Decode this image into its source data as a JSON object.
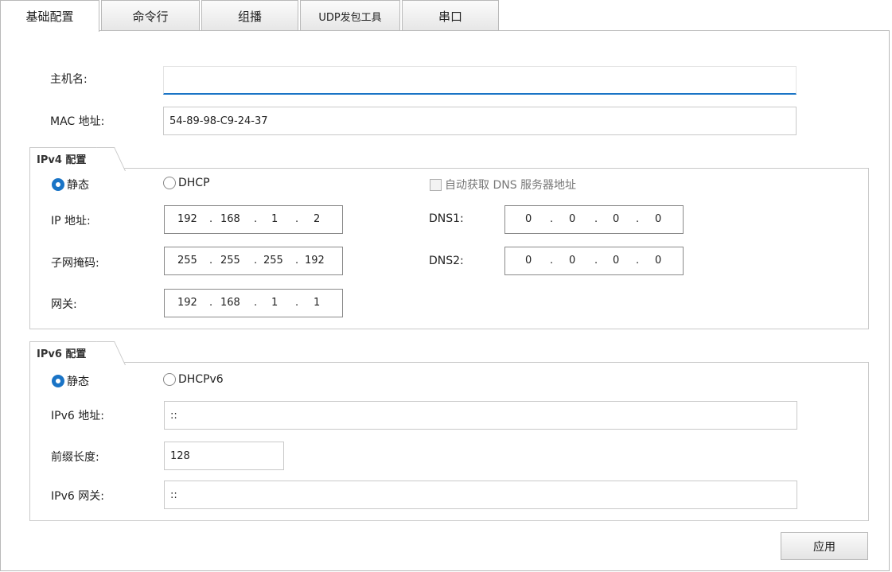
{
  "tabs": [
    {
      "label": "基础配置",
      "active": true
    },
    {
      "label": "命令行",
      "active": false
    },
    {
      "label": "组播",
      "active": false
    },
    {
      "label": "UDP发包工具",
      "active": false
    },
    {
      "label": "串口",
      "active": false
    }
  ],
  "basic": {
    "hostname_label": "主机名:",
    "hostname_value": "",
    "mac_label": "MAC 地址:",
    "mac_value": "54-89-98-C9-24-37"
  },
  "ipv4": {
    "legend": "IPv4 配置",
    "static_label": "静态",
    "dhcp_label": "DHCP",
    "mode": "static",
    "auto_dns_label": "自动获取 DNS 服务器地址",
    "auto_dns_checked": false,
    "ip_label": "IP 地址:",
    "ip": [
      "192",
      "168",
      "1",
      "2"
    ],
    "mask_label": "子网掩码:",
    "mask": [
      "255",
      "255",
      "255",
      "192"
    ],
    "gateway_label": "网关:",
    "gateway": [
      "192",
      "168",
      "1",
      "1"
    ],
    "dns1_label": "DNS1:",
    "dns1": [
      "0",
      "0",
      "0",
      "0"
    ],
    "dns2_label": "DNS2:",
    "dns2": [
      "0",
      "0",
      "0",
      "0"
    ]
  },
  "ipv6": {
    "legend": "IPv6 配置",
    "static_label": "静态",
    "dhcp_label": "DHCPv6",
    "mode": "static",
    "address_label": "IPv6 地址:",
    "address_value": "::",
    "prefix_label": "前缀长度:",
    "prefix_value": "128",
    "gateway_label": "IPv6 网关:",
    "gateway_value": "::"
  },
  "apply_label": "应用",
  "colors": {
    "accent": "#1a74c6",
    "border": "#c9c9c9"
  }
}
